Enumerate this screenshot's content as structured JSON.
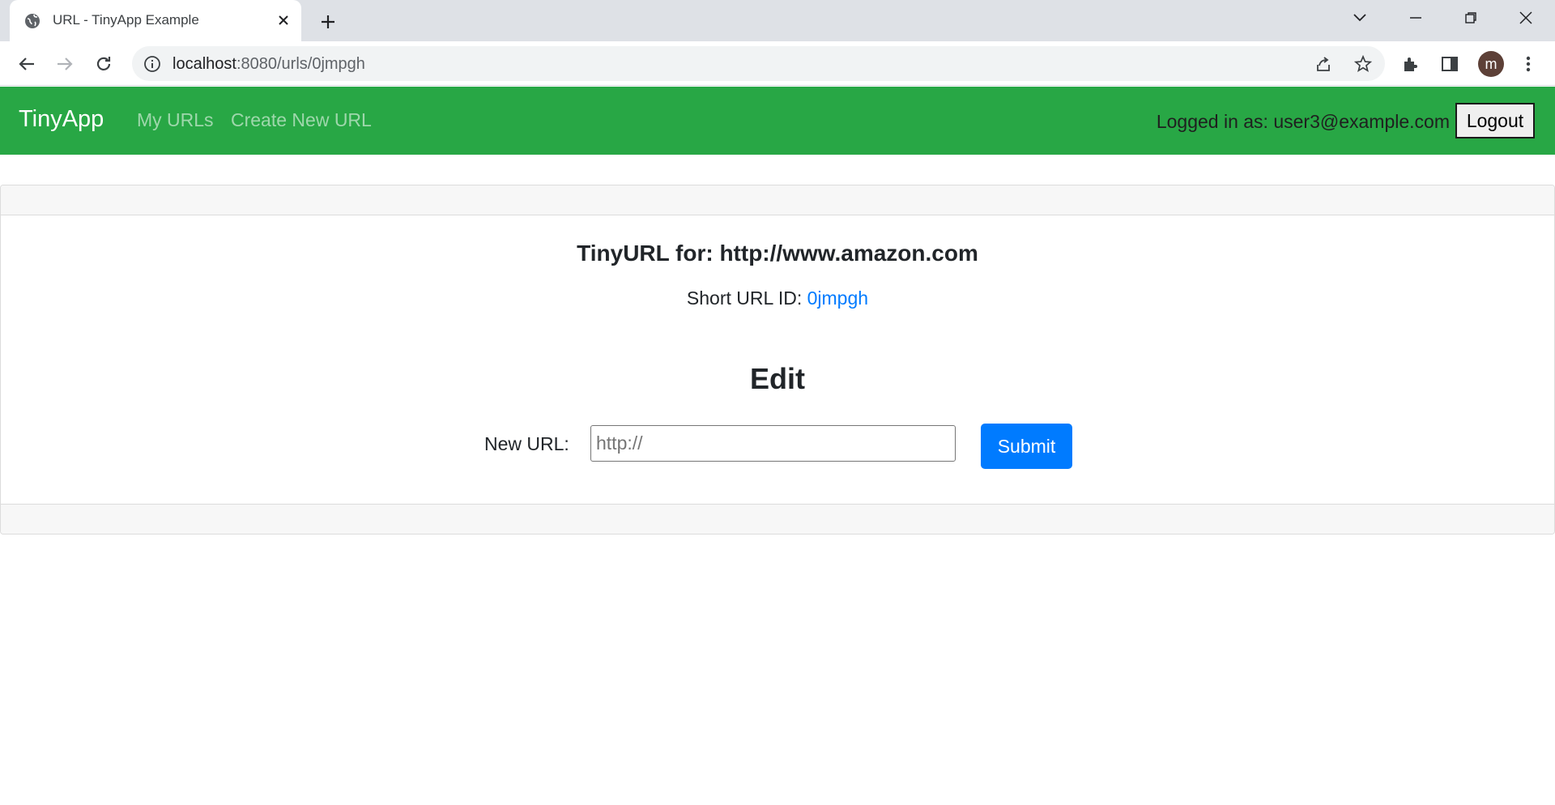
{
  "browser": {
    "tab_title": "URL - TinyApp Example",
    "url_host": "localhost",
    "url_rest": ":8080/urls/0jmpgh",
    "avatar_letter": "m",
    "icons": [
      "globe-icon",
      "close-icon",
      "plus-icon",
      "chevron-down-icon",
      "minimize-icon",
      "restore-icon",
      "window-close-icon",
      "back-arrow-icon",
      "forward-arrow-icon",
      "reload-icon",
      "info-icon",
      "share-icon",
      "star-icon",
      "extensions-icon",
      "side-panel-icon",
      "more-vert-icon"
    ]
  },
  "navbar": {
    "brand": "TinyApp",
    "links": [
      "My URLs",
      "Create New URL"
    ],
    "logged_in_text": "Logged in as: user3@example.com",
    "logout_label": "Logout",
    "color": "#28a745"
  },
  "content": {
    "title": "TinyURL for: http://www.amazon.com",
    "short_label": "Short URL ID: ",
    "short_id": "0jmpgh",
    "edit_heading": "Edit",
    "form_label": "New URL:",
    "input_placeholder": "http://",
    "input_value": "",
    "submit_label": "Submit",
    "link_color": "#007bff"
  }
}
